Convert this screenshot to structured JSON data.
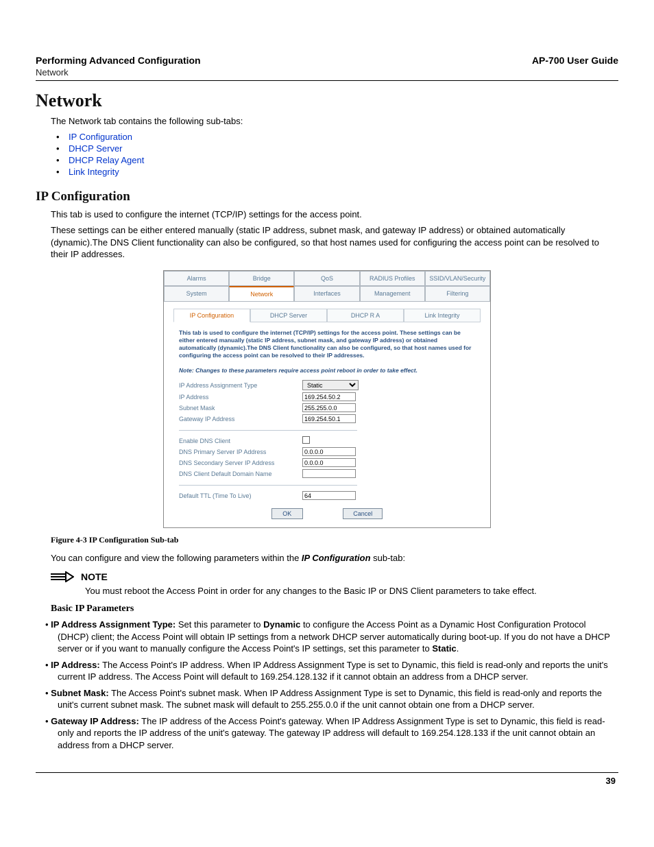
{
  "header": {
    "left_title": "Performing Advanced Configuration",
    "left_sub": "Network",
    "right": "AP-700 User Guide"
  },
  "section_title": "Network",
  "intro": "The Network tab contains the following sub-tabs:",
  "links": [
    "IP Configuration",
    "DHCP Server",
    "DHCP Relay Agent",
    "Link Integrity"
  ],
  "sub_title": "IP Configuration",
  "sub_p1": "This tab is used to configure the internet (TCP/IP) settings for the access point.",
  "sub_p2": "These settings can be either entered manually (static IP address, subnet mask, and gateway IP address) or obtained automatically (dynamic).The DNS Client functionality can also be configured, so that host names used for configuring the access point can be resolved to their IP addresses.",
  "shot": {
    "tabs_row1": [
      "Alarms",
      "Bridge",
      "QoS",
      "RADIUS Profiles",
      "SSID/VLAN/Security"
    ],
    "tabs_row2": [
      "System",
      "Network",
      "Interfaces",
      "Management",
      "Filtering"
    ],
    "tabs_row2_active": 1,
    "subtabs": [
      "IP Configuration",
      "DHCP Server",
      "DHCP R A",
      "Link Integrity"
    ],
    "subtabs_active": 0,
    "blurb": "This tab is used to configure the internet (TCP/IP) settings for the access point. These settings can be either entered manually (static IP address, subnet mask, and gateway IP address) or obtained automatically (dynamic).The DNS Client functionality can also be configured, so that host names used for configuring the access point can be resolved to their IP addresses.",
    "blurb_note": "Note: Changes to these parameters require access point reboot in order to take effect.",
    "fields1": {
      "assign_label": "IP Address Assignment Type",
      "assign_value": "Static",
      "ip_label": "IP Address",
      "ip_value": "169.254.50.2",
      "subnet_label": "Subnet Mask",
      "subnet_value": "255.255.0.0",
      "gw_label": "Gateway IP Address",
      "gw_value": "169.254.50.1"
    },
    "fields2": {
      "dns_enable_label": "Enable DNS Client",
      "dns1_label": "DNS Primary Server IP Address",
      "dns1_value": "0.0.0.0",
      "dns2_label": "DNS Secondary Server IP Address",
      "dns2_value": "0.0.0.0",
      "dnsdom_label": "DNS Client Default Domain Name",
      "dnsdom_value": ""
    },
    "fields3": {
      "ttl_label": "Default TTL (Time To Live)",
      "ttl_value": "64"
    },
    "ok": "OK",
    "cancel": "Cancel"
  },
  "figcap": "Figure 4-3    IP Configuration Sub-tab",
  "post_fig_intro_a": "You can configure and view the following parameters within the ",
  "post_fig_intro_b": "IP Configuration",
  "post_fig_intro_c": " sub-tab:",
  "note_label": "NOTE",
  "note_body": "You must reboot the Access Point in order for any changes to the Basic IP or DNS Client parameters to take effect.",
  "basic_ip_title": "Basic IP Parameters",
  "params": {
    "p1_label": "IP Address Assignment Type:",
    "p1_a": " Set this parameter to ",
    "p1_b": "Dynamic",
    "p1_c": " to configure the Access Point as a Dynamic Host Configuration Protocol (DHCP) client; the Access Point will obtain IP settings from a network DHCP server automatically during boot-up. If you do not have a DHCP server or if you want to manually configure the Access Point's IP settings, set this parameter to ",
    "p1_d": "Static",
    "p1_e": ".",
    "p2_label": "IP Address:",
    "p2_body": " The Access Point's IP address. When IP Address Assignment Type is set to Dynamic, this field is read-only and reports the unit's current IP address. The Access Point will default to 169.254.128.132 if it cannot obtain an address from a DHCP server.",
    "p3_label": "Subnet Mask:",
    "p3_body": " The Access Point's subnet mask. When IP Address Assignment Type is set to Dynamic, this field is read-only and reports the unit's current subnet mask. The subnet mask will default to 255.255.0.0 if the unit cannot obtain one from a DHCP server.",
    "p4_label": "Gateway IP Address:",
    "p4_body": " The IP address of the Access Point's gateway. When IP Address Assignment Type is set to Dynamic, this field is read-only and reports the IP address of the unit's gateway. The gateway IP address will default to 169.254.128.133 if the unit cannot obtain an address from a DHCP server."
  },
  "pagenum": "39"
}
